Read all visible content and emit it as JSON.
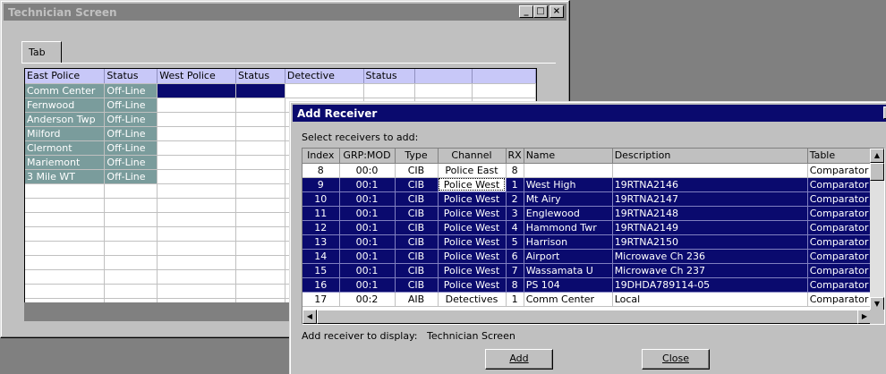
{
  "tech_window": {
    "title": "Technician Screen",
    "title_buttons": [
      "_",
      "□",
      "×"
    ],
    "tab_label": "Tab",
    "grid": {
      "headers": [
        "East Police",
        "Status",
        "West Police",
        "Status",
        "Detective",
        "Status",
        "",
        ""
      ],
      "rows": [
        [
          "Comm Center",
          "Off-Line"
        ],
        [
          "Fernwood",
          "Off-Line"
        ],
        [
          "Anderson Twp",
          "Off-Line"
        ],
        [
          "Milford",
          "Off-Line"
        ],
        [
          "Clermont",
          "Off-Line"
        ],
        [
          "Mariemont",
          "Off-Line"
        ],
        [
          "3 Mile WT",
          "Off-Line"
        ]
      ],
      "empty_rows": 9
    }
  },
  "dialog": {
    "title": "Add Receiver",
    "close_glyph": "×",
    "prompt": "Select receivers to add:",
    "columns": [
      "Index",
      "GRP:MOD",
      "Type",
      "Channel",
      "RX",
      "Name",
      "Description",
      "Table"
    ],
    "rows": [
      {
        "index": "8",
        "grp": "00:0",
        "type": "CIB",
        "channel": "Police East",
        "rx": "8",
        "name": "",
        "description": "",
        "table": "Comparator",
        "selected": false
      },
      {
        "index": "9",
        "grp": "00:1",
        "type": "CIB",
        "channel": "Police West",
        "rx": "1",
        "name": "West High",
        "description": "19RTNA2146",
        "table": "Comparator",
        "selected": true
      },
      {
        "index": "10",
        "grp": "00:1",
        "type": "CIB",
        "channel": "Police West",
        "rx": "2",
        "name": "Mt Airy",
        "description": "19RTNA2147",
        "table": "Comparator",
        "selected": true
      },
      {
        "index": "11",
        "grp": "00:1",
        "type": "CIB",
        "channel": "Police West",
        "rx": "3",
        "name": "Englewood",
        "description": "19RTNA2148",
        "table": "Comparator",
        "selected": true
      },
      {
        "index": "12",
        "grp": "00:1",
        "type": "CIB",
        "channel": "Police West",
        "rx": "4",
        "name": "Hammond Twr",
        "description": "19RTNA2149",
        "table": "Comparator",
        "selected": true
      },
      {
        "index": "13",
        "grp": "00:1",
        "type": "CIB",
        "channel": "Police West",
        "rx": "5",
        "name": "Harrison",
        "description": "19RTNA2150",
        "table": "Comparator",
        "selected": true
      },
      {
        "index": "14",
        "grp": "00:1",
        "type": "CIB",
        "channel": "Police West",
        "rx": "6",
        "name": "Airport",
        "description": "Microwave Ch 236",
        "table": "Comparator",
        "selected": true
      },
      {
        "index": "15",
        "grp": "00:1",
        "type": "CIB",
        "channel": "Police West",
        "rx": "7",
        "name": "Wassamata U",
        "description": "Microwave Ch 237",
        "table": "Comparator",
        "selected": true
      },
      {
        "index": "16",
        "grp": "00:1",
        "type": "CIB",
        "channel": "Police West",
        "rx": "8",
        "name": "PS 104",
        "description": "19DHDA789114-05",
        "table": "Comparator",
        "selected": true
      },
      {
        "index": "17",
        "grp": "00:2",
        "type": "AIB",
        "channel": "Detectives",
        "rx": "1",
        "name": "Comm Center",
        "description": "Local",
        "table": "Comparator",
        "selected": false
      }
    ],
    "footer_label": "Add receiver to display:",
    "footer_value": "Technician Screen",
    "add_button": "Add",
    "close_button": "Close"
  }
}
